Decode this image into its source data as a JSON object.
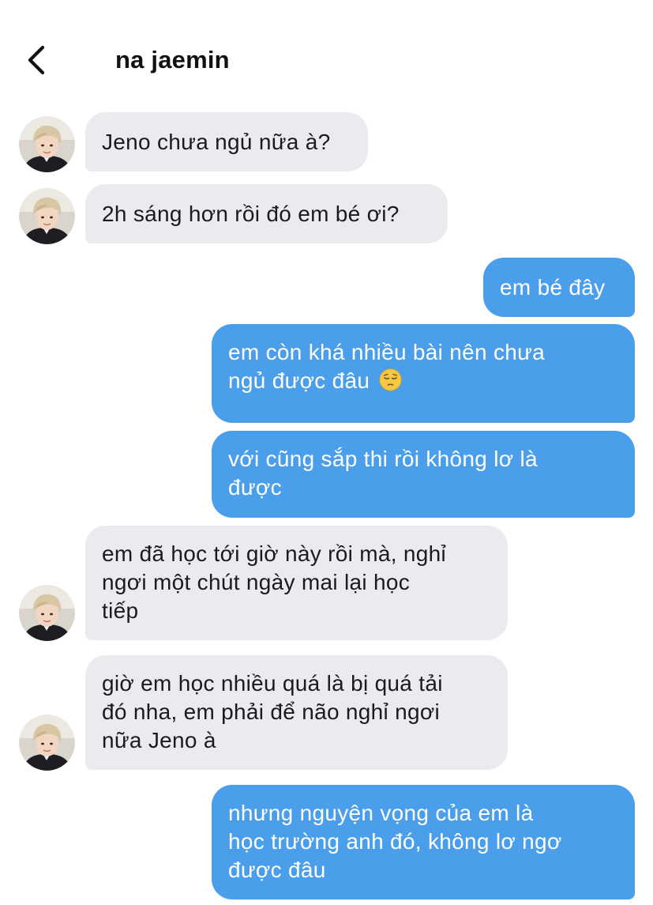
{
  "header": {
    "title": "na jaemin",
    "back_icon": "chevron-left-icon"
  },
  "contact": {
    "avatar_icon": "avatar-photo"
  },
  "messages": [
    {
      "from": "contact",
      "lines": [
        "Jeno chưa ngủ nữa à?"
      ]
    },
    {
      "from": "contact",
      "lines": [
        "2h sáng hơn rồi đó em bé ơi?"
      ]
    },
    {
      "from": "me",
      "lines": [
        "em bé đây"
      ]
    },
    {
      "from": "me",
      "lines": [
        "em còn khá nhiều bài nên chưa",
        "ngủ được đâu"
      ],
      "emoji": "pensive-face-icon"
    },
    {
      "from": "me",
      "lines": [
        "với cũng sắp thi rồi không lơ là",
        "được"
      ]
    },
    {
      "from": "contact",
      "lines": [
        "em đã học tới giờ này rồi mà, nghỉ",
        "ngơi một chút ngày mai lại học",
        "tiếp"
      ]
    },
    {
      "from": "contact",
      "lines": [
        "giờ em học nhiều quá là bị quá tải",
        "đó nha, em phải để não nghỉ ngơi",
        "nữa Jeno à"
      ]
    },
    {
      "from": "me",
      "lines": [
        "nhưng nguyện vọng của em là",
        "học trường anh đó, không lơ ngơ",
        "được đâu"
      ]
    }
  ],
  "colors": {
    "incoming_bubble": "#e9ebef",
    "outgoing_bubble": "#4b9fea",
    "outgoing_text": "#ffffff",
    "incoming_text": "#1b1b1b"
  }
}
